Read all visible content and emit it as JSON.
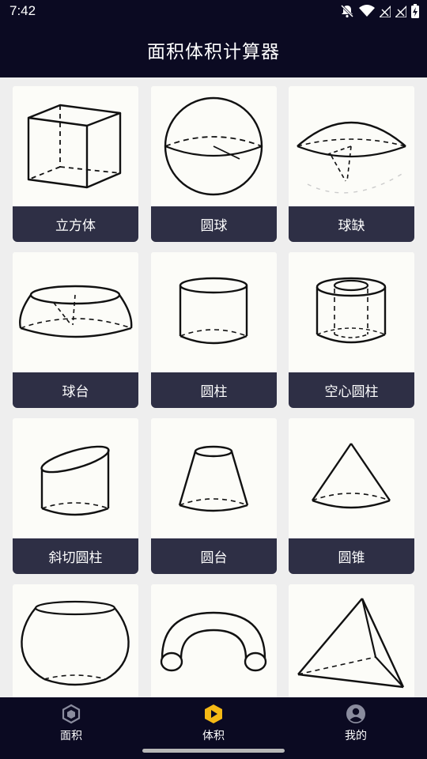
{
  "status_bar": {
    "time": "7:42"
  },
  "header": {
    "title": "面积体积计算器"
  },
  "shapes": [
    {
      "label": "立方体",
      "icon": "cube-icon"
    },
    {
      "label": "圆球",
      "icon": "sphere-icon"
    },
    {
      "label": "球缺",
      "icon": "spherical-cap-icon"
    },
    {
      "label": "球台",
      "icon": "spherical-frustum-icon"
    },
    {
      "label": "圆柱",
      "icon": "cylinder-icon"
    },
    {
      "label": "空心圆柱",
      "icon": "hollow-cylinder-icon"
    },
    {
      "label": "斜切圆柱",
      "icon": "oblique-cylinder-icon"
    },
    {
      "label": "圆台",
      "icon": "cone-frustum-icon"
    },
    {
      "label": "圆锥",
      "icon": "cone-icon"
    },
    {
      "label": "",
      "icon": "barrel-icon"
    },
    {
      "label": "",
      "icon": "torus-icon"
    },
    {
      "label": "",
      "icon": "tetrahedron-icon"
    }
  ],
  "bottom_nav": {
    "items": [
      {
        "label": "面积",
        "icon": "hexagon-icon",
        "active": false
      },
      {
        "label": "体积",
        "icon": "volume-play-icon",
        "active": true
      },
      {
        "label": "我的",
        "icon": "user-icon",
        "active": false
      }
    ],
    "active_color": "#f5b915"
  }
}
